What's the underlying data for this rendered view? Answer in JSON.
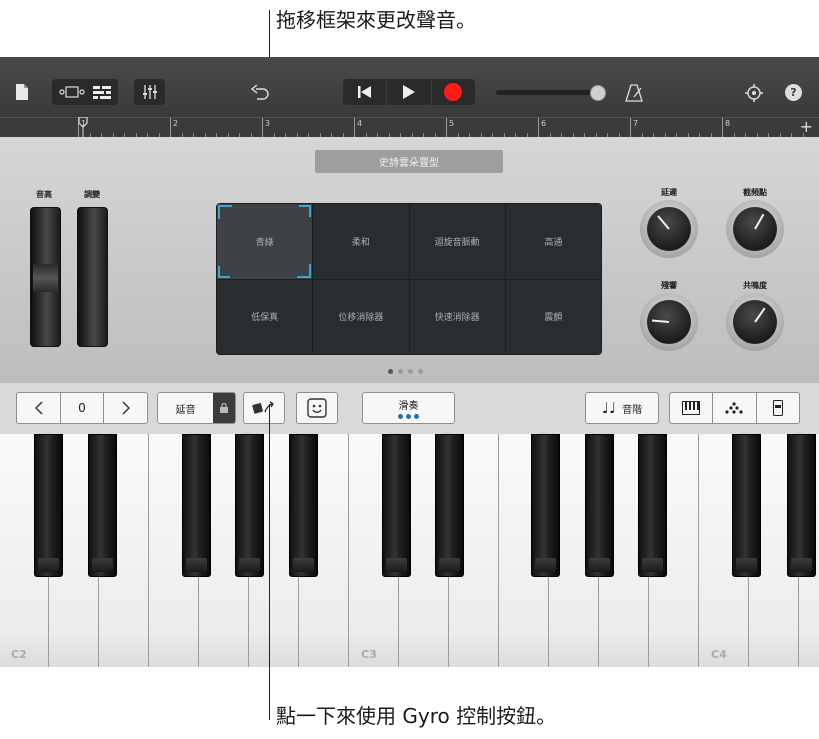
{
  "callouts": {
    "top": "拖移框架來更改聲音。",
    "bottom": "點一下來使用 Gyro 控制按鈕。"
  },
  "toolbar": {
    "icons": [
      "document-icon",
      "view-toggle-icon",
      "tracks-view-icon",
      "mixer-icon",
      "undo-icon",
      "rewind-icon",
      "play-icon",
      "record-icon",
      "metronome-icon",
      "settings-icon",
      "help-icon"
    ],
    "help_label": "?",
    "record_color": "#ff1a1a"
  },
  "ruler": {
    "bars": [
      "1",
      "2",
      "3",
      "4",
      "5",
      "6",
      "7",
      "8"
    ],
    "add_label": "+"
  },
  "instrument": {
    "patch_name": "史詩雲朵豐型",
    "wheels": {
      "pitch_label": "音高",
      "mod_label": "調變"
    },
    "sound_grid": [
      [
        "青綠",
        "柔和",
        "迴旋音脈動",
        "高通"
      ],
      [
        "低保真",
        "位移消除器",
        "快速消除器",
        "震顫"
      ]
    ],
    "selected_cell": "青綠",
    "page_dots": 4,
    "active_page": 1,
    "knobs": [
      {
        "label": "延遲",
        "angle": -40
      },
      {
        "label": "截頻點",
        "angle": 30
      },
      {
        "label": "殘響",
        "angle": -85
      },
      {
        "label": "共鳴度",
        "angle": 35
      }
    ],
    "accent_color": "#3aa8c6"
  },
  "controls": {
    "octave_value": "0",
    "sustain_label": "延音",
    "glide_label": "滑奏",
    "scale_label": "音階"
  },
  "keyboard": {
    "note_labels": {
      "c2": "C2",
      "c3": "C3",
      "c4": "C4"
    }
  }
}
